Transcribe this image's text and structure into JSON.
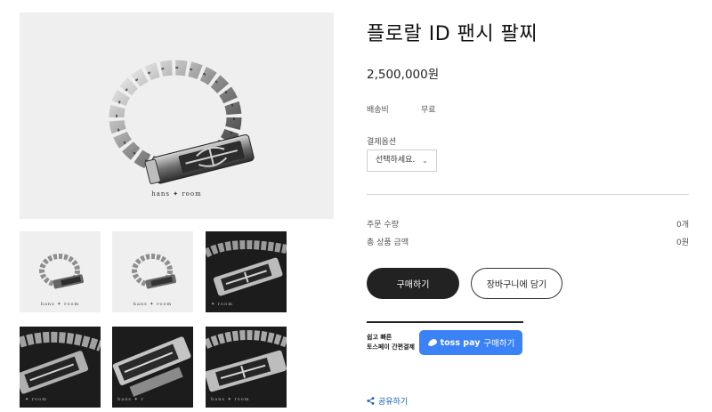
{
  "gallery": {
    "main_brand": "hans ✦ room",
    "thumbnails": [
      {
        "brand": "hans ✦ room",
        "style": "light"
      },
      {
        "brand": "hans ✦ room",
        "style": "light"
      },
      {
        "brand": "✦ room",
        "style": "dark"
      },
      {
        "brand": "✦ room",
        "style": "dark"
      },
      {
        "brand": "hans ✦ r",
        "style": "dark"
      },
      {
        "brand": "hans ✦ room",
        "style": "dark"
      }
    ]
  },
  "product": {
    "title": "플로랄 ID 팬시 팔찌",
    "price": "2,500,000원",
    "shipping_label": "배송비",
    "shipping_value": "무료",
    "payment_label": "결제옵션",
    "select_placeholder": "선택하세요.",
    "order_qty_label": "주문 수량",
    "order_qty_value": "0개",
    "total_label": "총 상품 금액",
    "total_value": "0원"
  },
  "actions": {
    "buy_label": "구매하기",
    "cart_label": "장바구니에 담기",
    "toss_note_line1": "쉽고 빠른",
    "toss_note_line2": "토스페이 간편결제",
    "toss_brand": "toss pay",
    "toss_label": "구매하기",
    "share_label": "공유하기"
  },
  "colors": {
    "buy_button": "#222222",
    "toss_button": "#3b82f6",
    "share_link": "#1a5fb4"
  }
}
